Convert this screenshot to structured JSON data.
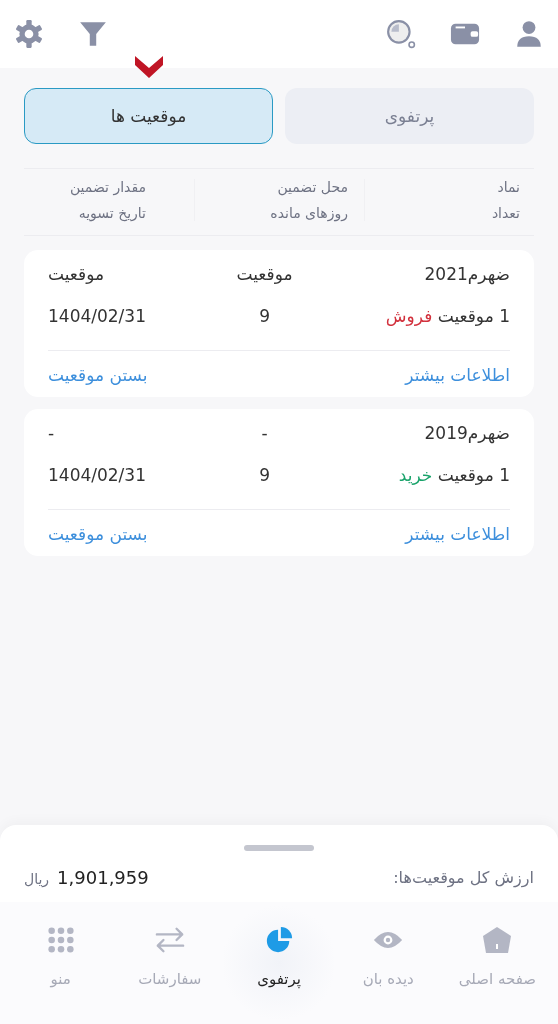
{
  "top_bar": {
    "icons": [
      {
        "kind": "user"
      },
      {
        "kind": "wallet"
      },
      {
        "kind": "search"
      },
      {
        "kind": "filter"
      },
      {
        "kind": "settings"
      }
    ]
  },
  "tabs": [
    {
      "label": "پرتفوی",
      "selected": false
    },
    {
      "label": "موقعیت ها",
      "selected": true
    }
  ],
  "column_headers": [
    {
      "line_1": "نماد",
      "line_2": "تعداد"
    },
    {
      "line_1": "محل تضمین",
      "line_2": "روزهای مانده"
    },
    {
      "line_1": "مقدار تضمین",
      "line_2": "تاریخ تسویه"
    }
  ],
  "positions": [
    {
      "symbol": "ضهرم2021",
      "column_2": "موقعیت",
      "column_3": "موقعیت",
      "count": "1 موقعیت",
      "side": {
        "label": "فروش",
        "color": "#d2303c"
      },
      "days": "9",
      "date": "1404/02/31",
      "more_link": "اطلاعات بیشتر",
      "close_link": "بستن موقعیت"
    },
    {
      "symbol": "ضهرم2019",
      "column_2": "-",
      "column_3": "-",
      "count": "1 موقعیت",
      "side": {
        "label": "خرید",
        "color": "#1aa36b"
      },
      "days": "9",
      "date": "1404/02/31",
      "more_link": "اطلاعات بیشتر",
      "close_link": "بستن موقعیت"
    }
  ],
  "summary": {
    "label": "ارزش کل موقعیت‌ها:",
    "value": "1,901,959",
    "currency": "ریال"
  },
  "bottom_nav": [
    {
      "label": "صفحه اصلی",
      "kind": "home",
      "selected": false
    },
    {
      "label": "دیده بان",
      "kind": "eye",
      "selected": false
    },
    {
      "label": "پرتفوی",
      "kind": "pie",
      "selected": true
    },
    {
      "label": "سفارشات",
      "kind": "swap",
      "selected": false
    },
    {
      "label": "منو",
      "kind": "grid",
      "selected": false
    }
  ]
}
